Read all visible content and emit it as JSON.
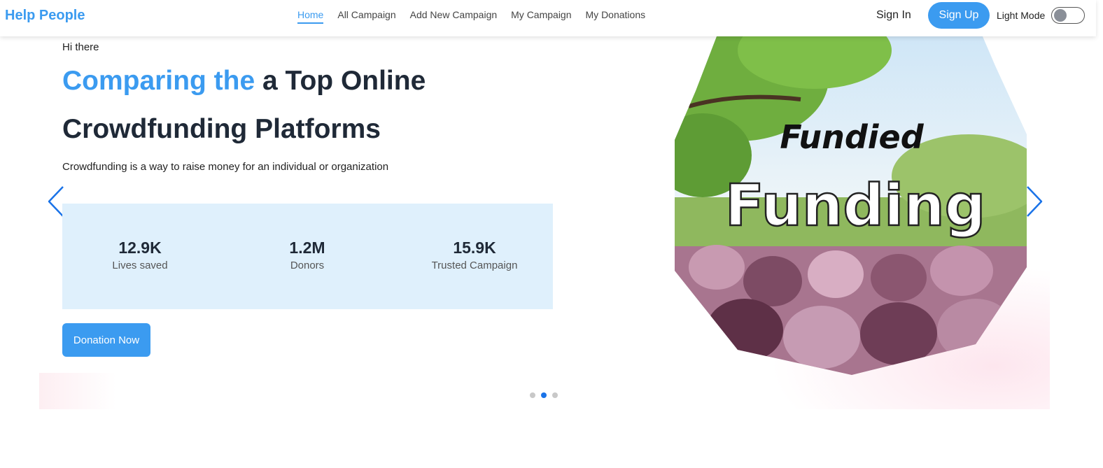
{
  "navbar": {
    "brand": "Help People",
    "links": [
      {
        "label": "Home",
        "active": true
      },
      {
        "label": "All Campaign"
      },
      {
        "label": "Add New Campaign"
      },
      {
        "label": "My Campaign"
      },
      {
        "label": "My Donations"
      }
    ],
    "sign_in": "Sign In",
    "sign_up": "Sign Up",
    "mode_label": "Light Mode",
    "mode_dark_enabled": false
  },
  "hero": {
    "greeting": "Hi there",
    "title_highlight": "Comparing the",
    "title_rest": " a Top Online",
    "title_line2": "Crowdfunding Platforms",
    "subtitle": "Crowdfunding is a way to raise money for an individual or organization",
    "stats": [
      {
        "value": "12.9K",
        "label": "Lives saved"
      },
      {
        "value": "1.2M",
        "label": "Donors"
      },
      {
        "value": "15.9K",
        "label": "Trusted Campaign"
      }
    ],
    "cta": "Donation Now",
    "image": {
      "headline": "Fundied",
      "word": "Funding"
    },
    "slides_count": 3,
    "active_slide": 2
  },
  "colors": {
    "accent": "#3b9bf0",
    "stats_bg": "#dff0fc",
    "arrow": "#1a73e8"
  }
}
